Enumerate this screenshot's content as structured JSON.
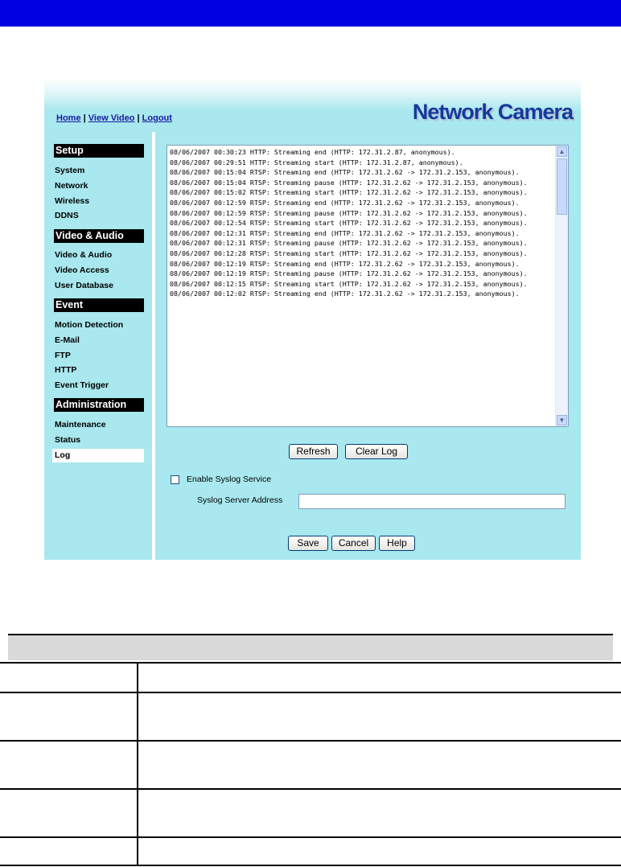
{
  "window": {
    "title_bar_color": "#0000e0"
  },
  "header": {
    "nav_links": [
      "Home",
      "View Video",
      "Logout"
    ],
    "separator": " | ",
    "brand": "Network Camera"
  },
  "sidebar": {
    "sections": [
      {
        "title": "Setup",
        "items": [
          "System",
          "Network",
          "Wireless",
          "DDNS"
        ]
      },
      {
        "title": "Video & Audio",
        "items": [
          "Video & Audio",
          "Video Access",
          "User Database"
        ]
      },
      {
        "title": "Event",
        "items": [
          "Motion Detection",
          "E-Mail",
          "FTP",
          "HTTP",
          "Event Trigger"
        ]
      },
      {
        "title": "Administration",
        "items": [
          "Maintenance",
          "Status",
          "Log"
        ]
      }
    ],
    "active_item": "Log"
  },
  "log": {
    "entries": [
      "08/06/2007 00:30:23 HTTP: Streaming end (HTTP: 172.31.2.87, anonymous).",
      "08/06/2007 00:29:51 HTTP: Streaming start (HTTP: 172.31.2.87, anonymous).",
      "08/06/2007 00:15:04 RTSP: Streaming end (HTTP: 172.31.2.62 -> 172.31.2.153, anonymous).",
      "08/06/2007 00:15:04 RTSP: Streaming pause (HTTP: 172.31.2.62 -> 172.31.2.153, anonymous).",
      "08/06/2007 00:15:02 RTSP: Streaming start (HTTP: 172.31.2.62 -> 172.31.2.153, anonymous).",
      "08/06/2007 00:12:59 RTSP: Streaming end (HTTP: 172.31.2.62 -> 172.31.2.153, anonymous).",
      "08/06/2007 00:12:59 RTSP: Streaming pause (HTTP: 172.31.2.62 -> 172.31.2.153, anonymous).",
      "08/06/2007 00:12:54 RTSP: Streaming start (HTTP: 172.31.2.62 -> 172.31.2.153, anonymous).",
      "08/06/2007 00:12:31 RTSP: Streaming end (HTTP: 172.31.2.62 -> 172.31.2.153, anonymous).",
      "08/06/2007 00:12:31 RTSP: Streaming pause (HTTP: 172.31.2.62 -> 172.31.2.153, anonymous).",
      "08/06/2007 00:12:28 RTSP: Streaming start (HTTP: 172.31.2.62 -> 172.31.2.153, anonymous).",
      "08/06/2007 00:12:19 RTSP: Streaming end (HTTP: 172.31.2.62 -> 172.31.2.153, anonymous).",
      "08/06/2007 00:12:19 RTSP: Streaming pause (HTTP: 172.31.2.62 -> 172.31.2.153, anonymous).",
      "08/06/2007 00:12:15 RTSP: Streaming start (HTTP: 172.31.2.62 -> 172.31.2.153, anonymous).",
      "08/06/2007 00:12:02 RTSP: Streaming end (HTTP: 172.31.2.62 -> 172.31.2.153, anonymous)."
    ]
  },
  "buttons": {
    "refresh": "Refresh",
    "clear_log": "Clear Log",
    "save": "Save",
    "cancel": "Cancel",
    "help": "Help"
  },
  "syslog": {
    "enable_label": "Enable Syslog Service",
    "enabled": false,
    "server_label": "Syslog Server Address",
    "server_value": ""
  },
  "colors": {
    "panel": "#a8e8ee",
    "brand_text": "#143a9c",
    "link": "#1a1aa0"
  }
}
